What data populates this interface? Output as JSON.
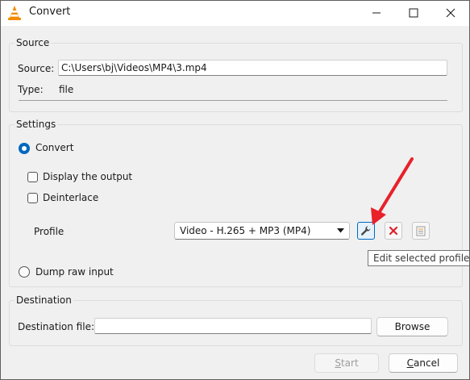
{
  "window": {
    "title": "Convert",
    "minimize_icon": "minimize-icon",
    "maximize_icon": "maximize-icon",
    "close_icon": "close-icon"
  },
  "source": {
    "group_title": "Source",
    "source_label": "Source:",
    "source_value": "C:\\Users\\bj\\Videos\\MP4\\3.mp4",
    "type_label": "Type:",
    "type_value": "file"
  },
  "settings": {
    "group_title": "Settings",
    "convert_label": "Convert",
    "convert_selected": true,
    "display_output_label": "Display the output",
    "display_output_checked": false,
    "deinterlace_label": "Deinterlace",
    "deinterlace_checked": false,
    "profile_label": "Profile",
    "profile_selected": "Video - H.265 + MP3 (MP4)",
    "edit_profile_icon": "wrench-icon",
    "delete_profile_icon": "red-x-icon",
    "new_profile_icon": "new-profile-icon",
    "tooltip": "Edit selected profile",
    "dump_raw_label": "Dump raw input",
    "dump_raw_selected": false
  },
  "destination": {
    "group_title": "Destination",
    "file_label": "Destination file:",
    "file_value": "",
    "browse_label": "Browse"
  },
  "footer": {
    "start_label": "Start",
    "start_mnemonic": "S",
    "start_rest": "tart",
    "start_enabled": false,
    "cancel_label": "Cancel",
    "cancel_mnemonic": "C",
    "cancel_rest": "ancel"
  },
  "annotation": {
    "arrow_color": "#e8212a"
  }
}
